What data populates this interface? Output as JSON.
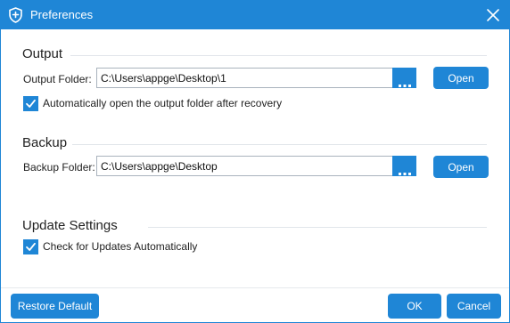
{
  "window": {
    "title": "Preferences",
    "accent_color": "#1f86d6",
    "icon": "shield-plus-icon"
  },
  "output": {
    "section_title": "Output",
    "folder_label": "Output Folder:",
    "folder_value": "C:\\Users\\appge\\Desktop\\1",
    "browse_icon": "ellipsis-icon",
    "open_label": "Open",
    "auto_open_checked": true,
    "auto_open_label": "Automatically open the output folder after recovery"
  },
  "backup": {
    "section_title": "Backup",
    "folder_label": "Backup Folder:",
    "folder_value": "C:\\Users\\appge\\Desktop",
    "browse_icon": "ellipsis-icon",
    "open_label": "Open"
  },
  "update": {
    "section_title": "Update Settings",
    "auto_check_checked": true,
    "auto_check_label": "Check for Updates Automatically"
  },
  "footer": {
    "restore_label": "Restore Default",
    "ok_label": "OK",
    "cancel_label": "Cancel"
  }
}
